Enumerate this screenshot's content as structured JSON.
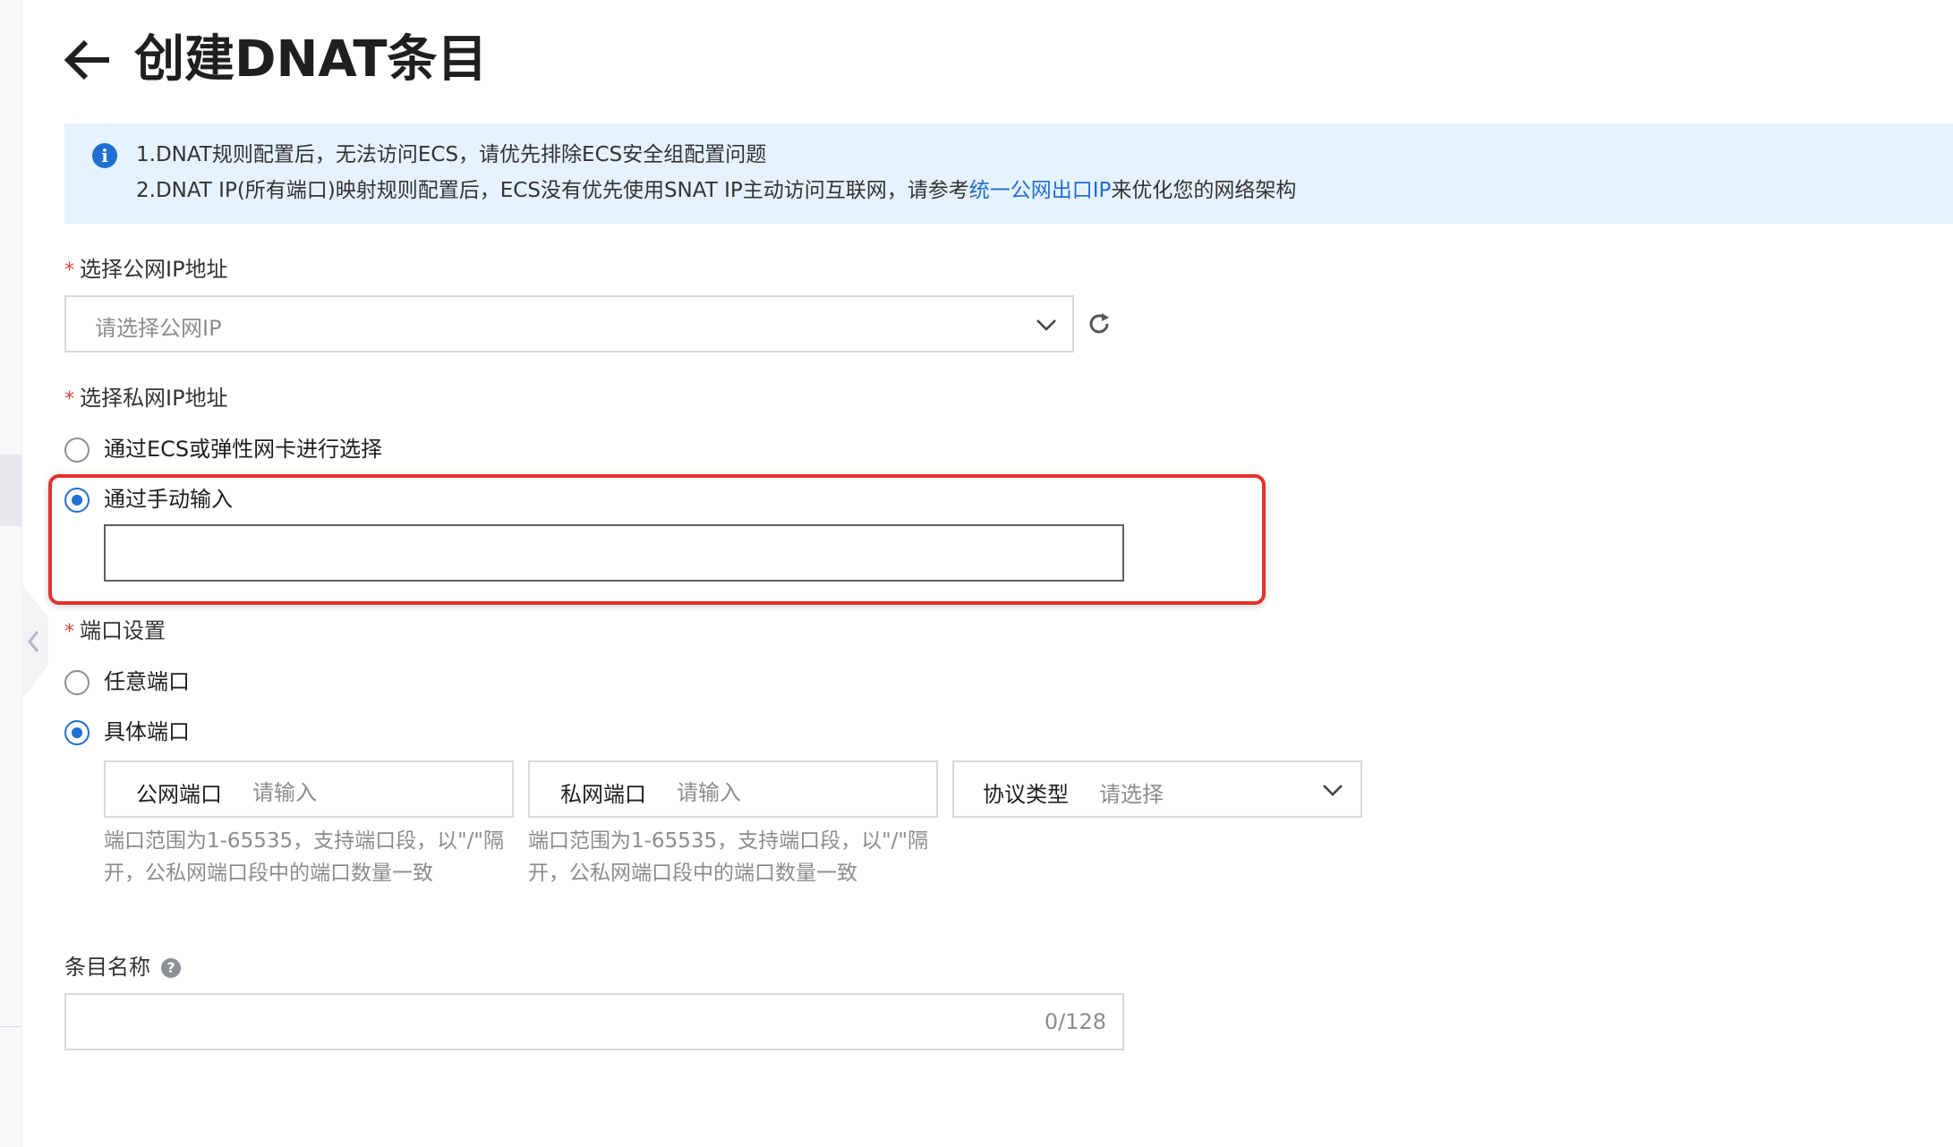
{
  "header": {
    "title": "创建DNAT条目"
  },
  "notice": {
    "line1": "1.DNAT规则配置后，无法访问ECS，请优先排除ECS安全组配置问题",
    "line2_prefix": "2.DNAT IP(所有端口)映射规则配置后，ECS没有优先使用SNAT IP主动访问互联网，请参考",
    "line2_link": "统一公网出口IP",
    "line2_suffix": "来优化您的网络架构"
  },
  "public_ip": {
    "label": "选择公网IP地址",
    "placeholder": "请选择公网IP"
  },
  "private_ip": {
    "label": "选择私网IP地址",
    "options": [
      {
        "label": "通过ECS或弹性网卡进行选择",
        "checked": false
      },
      {
        "label": "通过手动输入",
        "checked": true
      }
    ],
    "manual_value": ""
  },
  "port": {
    "label": "端口设置",
    "options": [
      {
        "label": "任意端口",
        "checked": false
      },
      {
        "label": "具体端口",
        "checked": true
      }
    ],
    "public_port": {
      "label": "公网端口",
      "placeholder": "请输入"
    },
    "private_port": {
      "label": "私网端口",
      "placeholder": "请输入"
    },
    "protocol": {
      "label": "协议类型",
      "placeholder": "请选择"
    },
    "help_text": "端口范围为1-65535，支持端口段，以\"/\"隔开，公私网端口段中的端口数量一致"
  },
  "entry_name": {
    "label": "条目名称",
    "help_icon": "?",
    "counter": "0/128"
  },
  "colors": {
    "accent": "#1f6ed1",
    "required": "#e2453a",
    "highlight": "#e0342c",
    "notice_bg": "#e6f2fd"
  }
}
